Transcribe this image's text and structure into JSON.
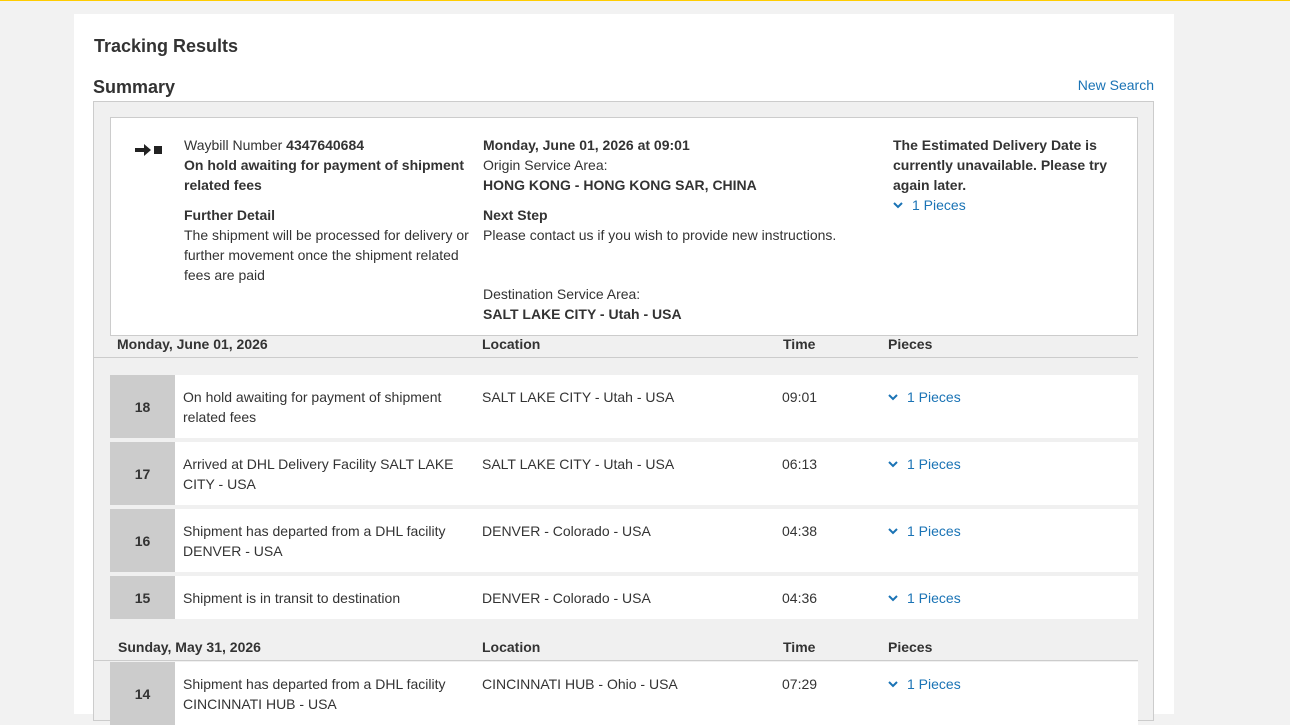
{
  "page": {
    "title": "Tracking Results",
    "summary_title": "Summary",
    "new_search": "New Search"
  },
  "summary": {
    "waybill_label": "Waybill Number",
    "waybill_number": "4347640684",
    "status": "On hold awaiting for payment of shipment related fees",
    "further_detail_label": "Further Detail",
    "further_detail": "The shipment will be processed for delivery or further movement once the shipment related fees are paid",
    "datetime": "Monday, June 01, 2026 at 09:01",
    "origin_label": "Origin Service Area:",
    "origin": "HONG KONG - HONG KONG SAR, CHINA",
    "next_step_label": "Next Step",
    "next_step": "Please contact us if you wish to provide new instructions.",
    "destination_label": "Destination Service Area:",
    "destination": "SALT LAKE CITY - Utah - USA",
    "estimated_delivery": "The Estimated Delivery Date is currently unavailable. Please try again later.",
    "pieces": "1 Pieces"
  },
  "columns": {
    "location": "Location",
    "time": "Time",
    "pieces": "Pieces"
  },
  "days": [
    {
      "date": "Monday, June 01, 2026",
      "events": [
        {
          "num": "18",
          "desc": "On hold awaiting for payment of shipment related fees",
          "location": "SALT LAKE CITY - Utah - USA",
          "time": "09:01",
          "pieces": "1 Pieces"
        },
        {
          "num": "17",
          "desc": "Arrived at DHL Delivery Facility SALT LAKE CITY - USA",
          "location": "SALT LAKE CITY - Utah - USA",
          "time": "06:13",
          "pieces": "1 Pieces"
        },
        {
          "num": "16",
          "desc": "Shipment has departed from a DHL facility DENVER - USA",
          "location": "DENVER - Colorado - USA",
          "time": "04:38",
          "pieces": "1 Pieces"
        },
        {
          "num": "15",
          "desc": "Shipment is in transit to destination",
          "location": "DENVER - Colorado - USA",
          "time": "04:36",
          "pieces": "1 Pieces"
        }
      ]
    },
    {
      "date": "Sunday, May 31, 2026",
      "events": [
        {
          "num": "14",
          "desc": "Shipment has departed from a DHL facility CINCINNATI HUB - USA",
          "location": "CINCINNATI HUB - Ohio - USA",
          "time": "07:29",
          "pieces": "1 Pieces"
        }
      ]
    }
  ],
  "colors": {
    "link": "#1a73b5",
    "accent": "#ffcc00",
    "number_bg": "#cccccc"
  }
}
